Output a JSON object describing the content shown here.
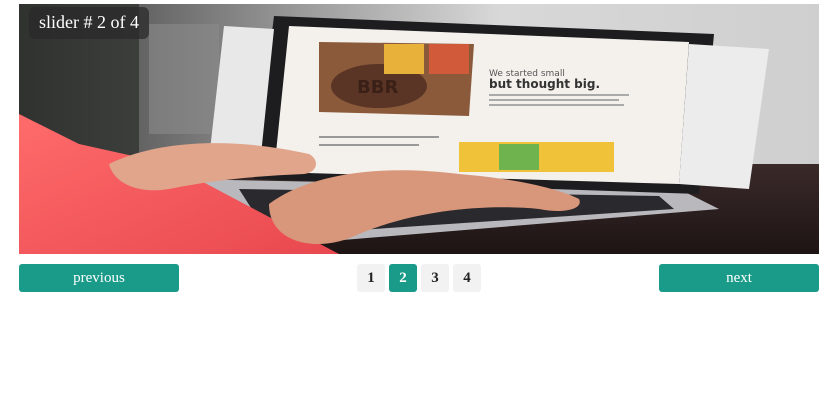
{
  "slider": {
    "badge": "slider # 2 of 4",
    "current_page": 2,
    "image": {
      "subject": "hands typing on laptop showing website",
      "screen_heading_line1": "We started small",
      "screen_heading_line2": "but thought big.",
      "screen_logo_text": "BBR"
    }
  },
  "controls": {
    "previous_label": "previous",
    "next_label": "next",
    "pages": [
      "1",
      "2",
      "3",
      "4"
    ]
  },
  "colors": {
    "accent": "#1a9a88",
    "page_bg": "#f2f2f2"
  }
}
